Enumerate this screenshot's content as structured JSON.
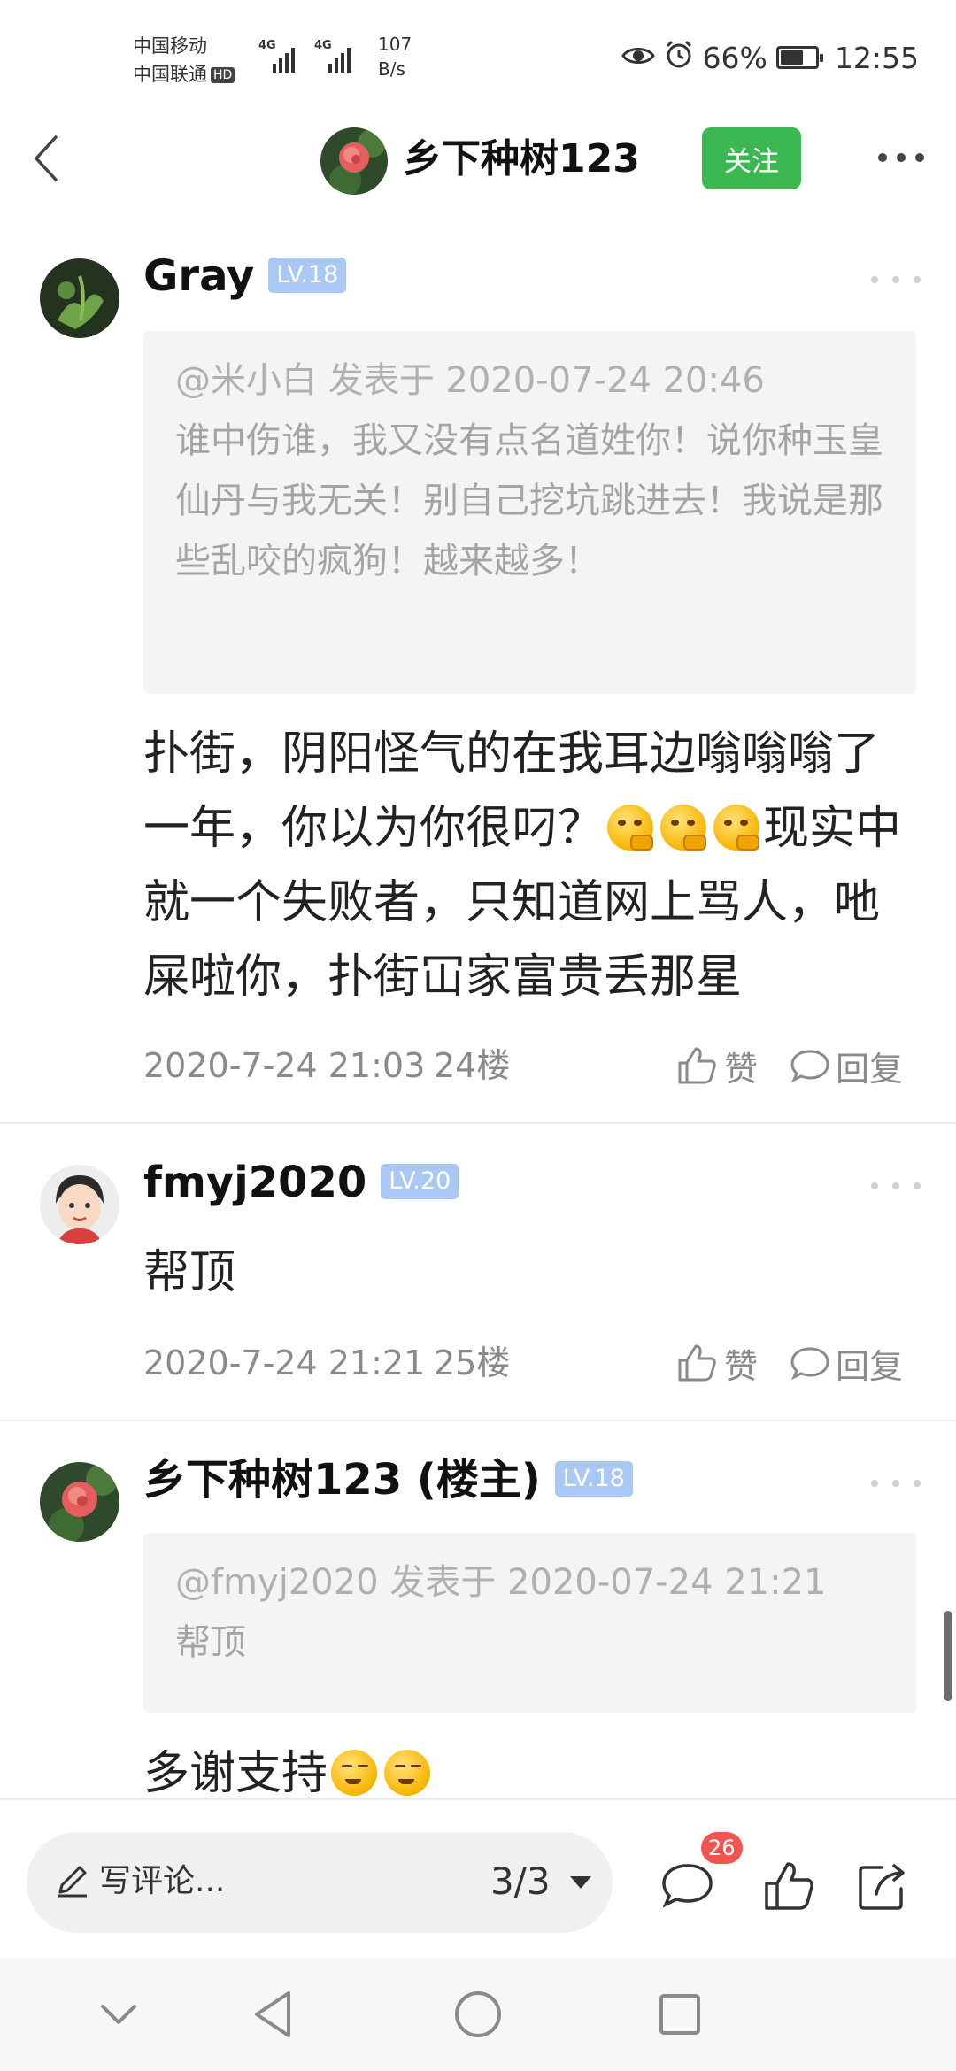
{
  "status_bar": {
    "carrier1": "中国移动",
    "carrier2": "中国联通",
    "hd": "HD",
    "signal_tag1": "4G",
    "signal_tag2": "4G",
    "net_speed_value": "107",
    "net_speed_unit": "B/s",
    "battery_percent": "66%",
    "time": "12:55"
  },
  "header": {
    "title": "乡下种树123",
    "follow_label": "关注"
  },
  "posts": [
    {
      "username": "Gray",
      "level": "LV.18",
      "quote_meta": "@米小白 发表于 2020-07-24 20:46",
      "quote_text": "谁中伤谁，我又没有点名道姓你！说你种玉皇仙丹与我无关！别自己挖坑跳进去！我说是那些乱咬的疯狗！越来越多！",
      "content_part1": "扑街，阴阳怪气的在我耳边嗡嗡嗡了一年，你以为你很叼？",
      "content_part2": "现实中就一个失败者，只知道网上骂人，吔屎啦你，扑街冚家富贵丢那星",
      "date": "2020-7-24 21:03",
      "floor": "24楼",
      "like_label": "赞",
      "reply_label": "回复"
    },
    {
      "username": "fmyj2020",
      "level": "LV.20",
      "content": "帮顶",
      "date": "2020-7-24 21:21",
      "floor": "25楼",
      "like_label": "赞",
      "reply_label": "回复"
    },
    {
      "username": "乡下种树123 (楼主)",
      "level": "LV.18",
      "quote_meta": "@fmyj2020 发表于 2020-07-24 21:21",
      "quote_text": "帮顶",
      "content": "多谢支持"
    }
  ],
  "bottom_bar": {
    "comment_placeholder": "写评论...",
    "page_indicator": "3/3",
    "comment_count": "26"
  },
  "icons": {
    "back": "chevron-left-icon",
    "more": "more-horizontal-icon",
    "like": "thumbs-up-icon",
    "reply": "speech-bubble-icon",
    "share": "share-icon",
    "pen": "pen-icon",
    "eye": "eye-icon",
    "alarm": "alarm-icon",
    "battery": "battery-icon"
  },
  "colors": {
    "follow": "#3cb853",
    "level_badge": "#a9c8f3",
    "badge": "#f2554f"
  },
  "battery_level": 0.66
}
